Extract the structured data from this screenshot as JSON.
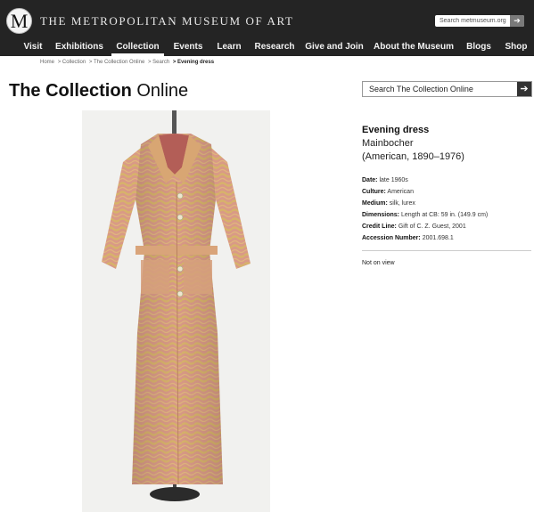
{
  "header": {
    "logo_letter": "M",
    "museum_name": "THE METROPOLITAN MUSEUM OF ART",
    "search_placeholder": "Search metmuseum.org",
    "search_go": "➔"
  },
  "nav": {
    "items": [
      {
        "label": "Visit",
        "active": false
      },
      {
        "label": "Exhibitions",
        "active": false
      },
      {
        "label": "Collection",
        "active": true
      },
      {
        "label": "Events",
        "active": false
      },
      {
        "label": "Learn",
        "active": false
      },
      {
        "label": "Research",
        "active": false
      },
      {
        "label": "Give and Join",
        "active": false
      },
      {
        "label": "About the Museum",
        "active": false
      },
      {
        "label": "Blogs",
        "active": false
      },
      {
        "label": "Shop",
        "active": false
      }
    ]
  },
  "breadcrumb": {
    "items": [
      "Home",
      "> Collection",
      "> The Collection Online",
      "> Search"
    ],
    "current": "> Evening dress"
  },
  "page": {
    "title_bold": "The Collection",
    "title_light": "Online",
    "collection_search_placeholder": "Search The Collection Online",
    "collection_search_go": "➔"
  },
  "object": {
    "title": "Evening dress",
    "artist": "Mainbocher",
    "artist_bio": "(American, 1890–1976)",
    "facts": [
      {
        "label": "Date:",
        "value": "late 1960s"
      },
      {
        "label": "Culture:",
        "value": "American"
      },
      {
        "label": "Medium:",
        "value": "silk, lurex"
      },
      {
        "label": "Dimensions:",
        "value": "Length at CB: 59 in. (149.9 cm)"
      },
      {
        "label": "Credit Line:",
        "value": "Gift of C. Z. Guest, 2001"
      },
      {
        "label": "Accession Number:",
        "value": "2001.698.1"
      }
    ],
    "on_view": "Not on view"
  },
  "colors": {
    "header_bg": "#242424",
    "dress_pink": "#d99a86",
    "dress_gold": "#d7b36a"
  }
}
